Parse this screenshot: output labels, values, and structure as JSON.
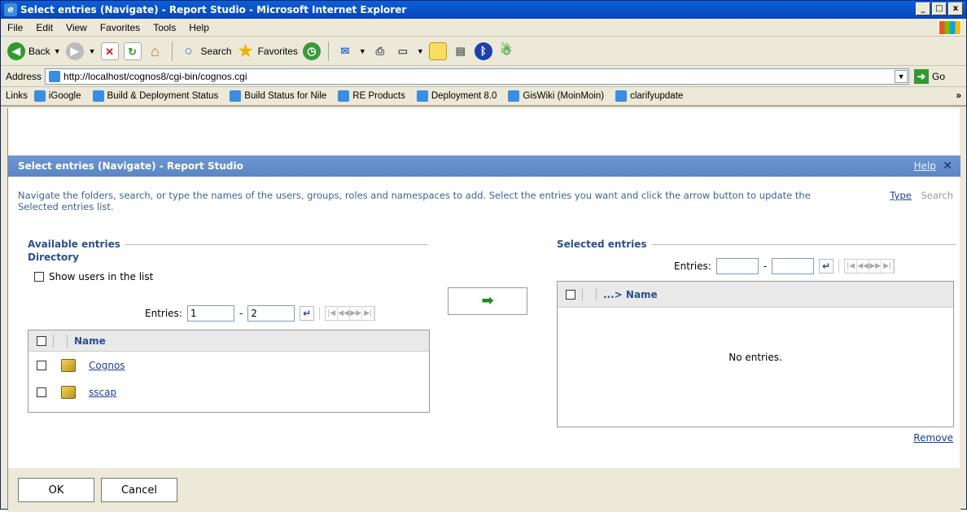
{
  "window": {
    "title": "Select entries (Navigate) - Report Studio - Microsoft Internet Explorer",
    "btn_min": "_",
    "btn_max": "□",
    "btn_close": "x"
  },
  "menu": [
    "File",
    "Edit",
    "View",
    "Favorites",
    "Tools",
    "Help"
  ],
  "toolbar": {
    "back": "Back",
    "search": "Search",
    "favorites": "Favorites"
  },
  "address": {
    "label": "Address",
    "url": "http://localhost/cognos8/cgi-bin/cognos.cgi",
    "go": "Go"
  },
  "links": {
    "label": "Links",
    "items": [
      "iGoogle",
      "Build & Deployment Status",
      "Build Status for Nile",
      "RE Products",
      "Deployment 8.0",
      "GisWiki (MoinMoin)",
      "clarifyupdate"
    ]
  },
  "dialog": {
    "title": "Select entries (Navigate) - Report Studio",
    "help": "Help",
    "close": "✕",
    "intro": "Navigate the folders, search, or type the names of the users, groups, roles and namespaces to add. Select the entries you want and click the arrow button to update the Selected entries list.",
    "type_link": "Type",
    "search_link": "Search",
    "available": {
      "title": "Available entries",
      "subtitle": "Directory",
      "show_users": "Show users in the list",
      "entries_label": "Entries:",
      "from": "1",
      "to": "2",
      "col_name": "Name",
      "rows": [
        "Cognos",
        "sscap"
      ]
    },
    "arrow": "➡",
    "selected": {
      "title": "Selected entries",
      "entries_label": "Entries:",
      "from": "",
      "to": "",
      "col_name": "...> Name",
      "empty": "No entries.",
      "remove": "Remove"
    },
    "ok": "OK",
    "cancel": "Cancel"
  }
}
